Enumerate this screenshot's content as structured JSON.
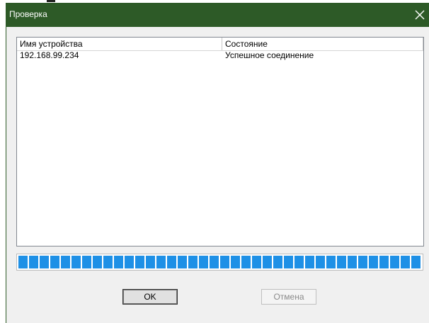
{
  "window": {
    "title": "Проверка"
  },
  "list": {
    "columns": [
      "Имя устройства",
      "Состояние"
    ],
    "rows": [
      [
        "192.168.99.234",
        "Успешное соединение"
      ]
    ]
  },
  "progress": {
    "value_percent": 100,
    "color": "#1e90e6"
  },
  "buttons": {
    "ok_label": "OK",
    "cancel_label": "Отмена"
  },
  "colors": {
    "titlebar": "#2d5a27",
    "progress_fill": "#1e90e6"
  },
  "icons": {
    "close": "close-icon"
  }
}
